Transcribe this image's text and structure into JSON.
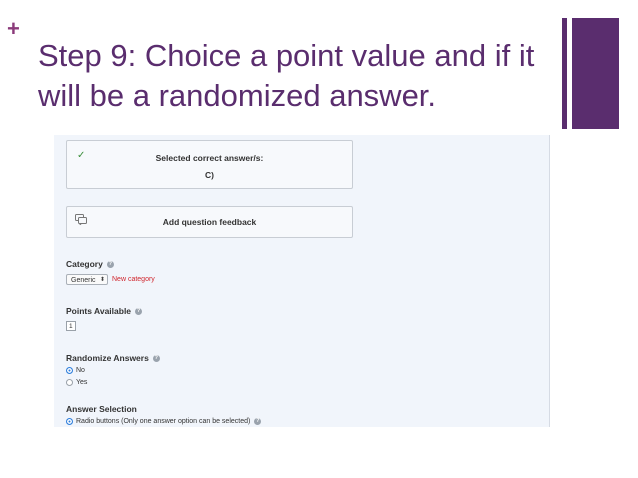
{
  "slide": {
    "bullet": "+",
    "title": "Step 9: Choice a point value and if it will be a randomized answer."
  },
  "colors": {
    "accent": "#5a2d6e",
    "bullet": "#8b3a7a",
    "link_red": "#d0262d",
    "radio_blue": "#2f7fdc"
  },
  "screenshot": {
    "correct_answer": {
      "icon": "check-icon",
      "heading": "Selected correct answer/s:",
      "value": "C)"
    },
    "feedback": {
      "icon": "comment-icon",
      "label": "Add question feedback"
    },
    "category": {
      "label": "Category",
      "help": "?",
      "selected": "Generic",
      "select_arrows": "⬍",
      "new_link": "New category"
    },
    "points": {
      "label": "Points Available",
      "help": "?",
      "value": "1"
    },
    "randomize": {
      "label": "Randomize Answers",
      "help": "?",
      "options": [
        {
          "label": "No",
          "selected": true
        },
        {
          "label": "Yes",
          "selected": false
        }
      ]
    },
    "answer_selection": {
      "label": "Answer Selection",
      "option_label": "Radio buttons (Only one answer option can be selected)",
      "help": "?"
    }
  }
}
